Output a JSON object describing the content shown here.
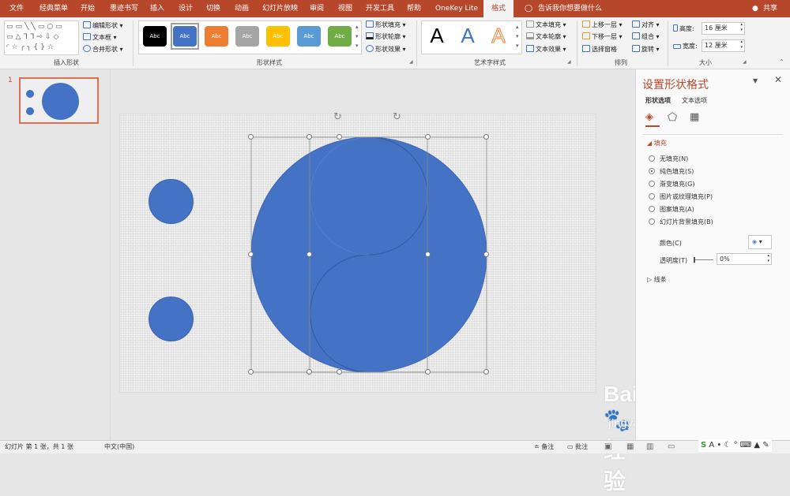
{
  "tabs": [
    "文件",
    "经典菜单",
    "开始",
    "墨迹书写",
    "插入",
    "设计",
    "切换",
    "动画",
    "幻灯片放映",
    "审阅",
    "视图",
    "开发工具",
    "帮助",
    "OneKey Lite",
    "格式"
  ],
  "tell_me": "告诉我你想要做什么",
  "share": "共享",
  "groups": {
    "insert_shapes": {
      "label": "插入形状",
      "edit_shape": "编辑形状",
      "text_box": "文本框",
      "merge_shapes": "合并形状"
    },
    "shape_styles": {
      "label": "形状样式",
      "swatch_text": "Abc",
      "fill": "形状填充",
      "outline": "形状轮廓",
      "effects": "形状效果"
    },
    "wordart": {
      "label": "艺术字样式",
      "sample": "A",
      "text_fill": "文本填充",
      "text_outline": "文本轮廓",
      "text_effects": "文本效果"
    },
    "arrange": {
      "label": "排列",
      "bring_forward": "上移一层",
      "send_backward": "下移一层",
      "selection_pane": "选择窗格",
      "align": "对齐",
      "group": "组合",
      "rotate": "旋转"
    },
    "size": {
      "label": "大小",
      "height_label": "高度:",
      "height_value": "16 厘米",
      "width_label": "宽度:",
      "width_value": "12 厘米"
    }
  },
  "swatch_colors": [
    "#000000",
    "#4472c4",
    "#ed7d31",
    "#a5a5a5",
    "#ffc000",
    "#5b9bd5",
    "#70ad47"
  ],
  "accent_color": "#b7472a",
  "shape_color": "#4472c4",
  "thumbnail": {
    "number": "1"
  },
  "format_pane": {
    "title": "设置形状格式",
    "tab_shape": "形状选项",
    "tab_text": "文本选项",
    "fill_section": "填充",
    "options": [
      "无填充(N)",
      "纯色填充(S)",
      "渐变填充(G)",
      "图片或纹理填充(P)",
      "图案填充(A)",
      "幻灯片背景填充(B)"
    ],
    "selected_option": "纯色填充(S)",
    "color_label": "颜色(C)",
    "transparency_label": "透明度(T)",
    "transparency_value": "0%",
    "line_section": "线条"
  },
  "status": {
    "slide_info": "幻灯片 第 1 张，共 1 张",
    "language": "中文(中国)",
    "notes": "备注",
    "comments": "批注"
  }
}
